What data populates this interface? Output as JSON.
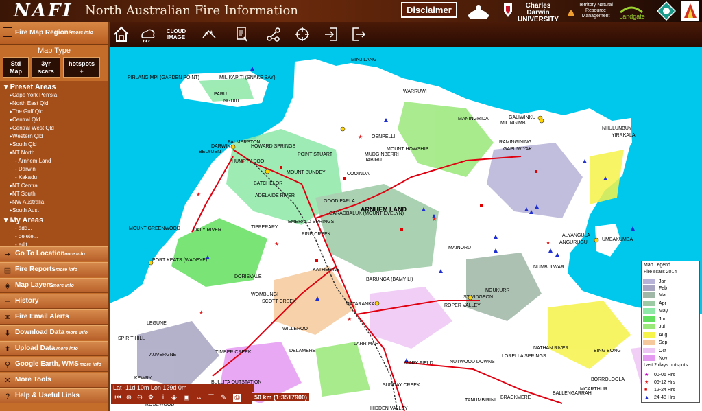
{
  "header": {
    "logo": "NAFI",
    "title": "North Australian Fire Information",
    "disclaimer": "Disclaimer",
    "partners": [
      "Charles Darwin UNIVERSITY",
      "Territory Natural Resource Management",
      "Landgate"
    ]
  },
  "sidebar": {
    "fire_map_regions": "Fire Map Regions",
    "more_info": "more info",
    "map_type_label": "Map Type",
    "map_types": [
      {
        "line1": "Std",
        "line2": "Map"
      },
      {
        "line1": "3yr",
        "line2": "scars"
      },
      {
        "line1": "hotspots",
        "line2": "+"
      }
    ],
    "preset_title": "Preset Areas",
    "presets": [
      "Cape York Pen'sla",
      "North East Qld",
      "The Gulf Qld",
      "Central Qld",
      "Central West Qld",
      "Western Qld",
      "South Qld",
      "NT North"
    ],
    "nt_north_subs": [
      "Arnhem Land",
      "Darwin",
      "Kakadu"
    ],
    "presets_after": [
      "NT Central",
      "NT South",
      "NW Australia",
      "South Aust"
    ],
    "my_areas_title": "My Areas",
    "my_areas": [
      "add...",
      "delete...",
      "edit..."
    ],
    "menu": [
      {
        "label": "Go To Location",
        "more": "more info",
        "icon": "goto-icon"
      },
      {
        "label": "Fire Reports",
        "more": "more info",
        "icon": "report-icon"
      },
      {
        "label": "Map Layers",
        "more": "more info",
        "icon": "layers-icon"
      },
      {
        "label": "History",
        "more": "",
        "icon": "history-icon"
      },
      {
        "label": "Fire Email Alerts",
        "more": "",
        "icon": "email-icon"
      },
      {
        "label": "Download Data",
        "more": "more info",
        "icon": "download-icon"
      },
      {
        "label": "Upload Data",
        "more": "more info",
        "icon": "upload-icon"
      },
      {
        "label": "Google Earth, WMS",
        "more": "more info",
        "icon": "search-icon"
      },
      {
        "label": "More Tools",
        "more": "",
        "icon": "tools-icon"
      },
      {
        "label": "Help & Useful Links",
        "more": "",
        "icon": "help-icon"
      }
    ]
  },
  "toolbar": {
    "cloud_image_line1": "CLOUD",
    "cloud_image_line2": "IMAGE"
  },
  "map": {
    "places": [
      "MINJILANG",
      "PIRLANGIMPI (GARDEN POINT)",
      "MILIKAPITI (SNAKE BAY)",
      "PARU",
      "NGUIU",
      "WARRUWI",
      "MANINGRIDA",
      "GALIWINKU",
      "MILINGIMBI",
      "NHULUNBUY",
      "YIRRKALA",
      "RAMINGINING",
      "GAPUWIYAK",
      "PALMERSTON",
      "DARWIN",
      "BELYUEN",
      "HOWARD SPRINGS",
      "HUMPTY DOO",
      "POINT STUART",
      "OENPELLI",
      "MOUNT HOWSHIP",
      "MUDGINBERRI",
      "JABIRU",
      "MOUNT BUNDEY",
      "COOINDA",
      "BATCHELOR",
      "ADELAIDE RIVER",
      "GOOD PARLA",
      "ARNHEM LAND",
      "GARADBALUK (MOUNT EVELYN)",
      "MOUNT GREENWOOD",
      "DALY RIVER",
      "TIPPERARY",
      "EMERALD SPRINGS",
      "PINE CREEK",
      "PORT KEATS (WADEYE)",
      "DORISVALE",
      "KATHERINE",
      "WOMBUNGI",
      "SCOTT CREEK",
      "BARUNGA (BAMYILI)",
      "MATARANKA",
      "ROPER VALLEY",
      "NGUKURR",
      "ST VIDGEON",
      "MAINORU",
      "ALYANGULA",
      "ANGURUGU",
      "UMBAKUMBA",
      "NUMBULWAR",
      "LEGUNE",
      "SPIRIT HILL",
      "WILLEROO",
      "AUVERGNE",
      "TIMBER CREEK",
      "DELAMERE",
      "LARRIMAH",
      "MARY FIELD",
      "NUTWOOD DOWNS",
      "LORELLA SPRINGS",
      "NATHAN RIVER",
      "BING BONG",
      "KEWRY",
      "BULLITA OUTSTATION",
      "SUNDAY CREEK",
      "BORROLOOLA",
      "MCARTHUR",
      "BRACKMERE",
      "TANUMBIRINI",
      "ROSEWOOD",
      "HIDDEN VALLEY",
      "BALLENGARRAH"
    ]
  },
  "legend": {
    "title": "Map Legend",
    "subtitle": "Fire scars 2014",
    "months": [
      {
        "label": "Jan",
        "color": "#b7b3d8"
      },
      {
        "label": "Feb",
        "color": "#a8a5c2"
      },
      {
        "label": "Mar",
        "color": "#9fb7a6"
      },
      {
        "label": "Apr",
        "color": "#9ccaa4"
      },
      {
        "label": "May",
        "color": "#8ee8a8"
      },
      {
        "label": "Jun",
        "color": "#64e060"
      },
      {
        "label": "Jul",
        "color": "#9ae87a"
      },
      {
        "label": "Aug",
        "color": "#f6f34a"
      },
      {
        "label": "Sep",
        "color": "#f5c99b"
      },
      {
        "label": "Oct",
        "color": "#eec6f5"
      },
      {
        "label": "Nov",
        "color": "#e59af1"
      }
    ],
    "hotspots_title": "Last 2 days hotspots",
    "hotspots": [
      {
        "label": "00-06 Hrs",
        "symbol": "★",
        "color": "#c000c0"
      },
      {
        "label": "06-12 Hrs",
        "symbol": "★",
        "color": "#e02020"
      },
      {
        "label": "12-24 Hrs",
        "symbol": "■",
        "color": "#e00000"
      },
      {
        "label": "24-48 Hrs",
        "symbol": "▲",
        "color": "#2030d0"
      }
    ]
  },
  "status": {
    "coords": "Lat -11d 10m Lon 129d 0m",
    "scale": "50 km (1:3517900)"
  },
  "colors": {
    "ocean": "#00c8ec",
    "land": "#ffffff",
    "accent": "#c46d2b"
  }
}
